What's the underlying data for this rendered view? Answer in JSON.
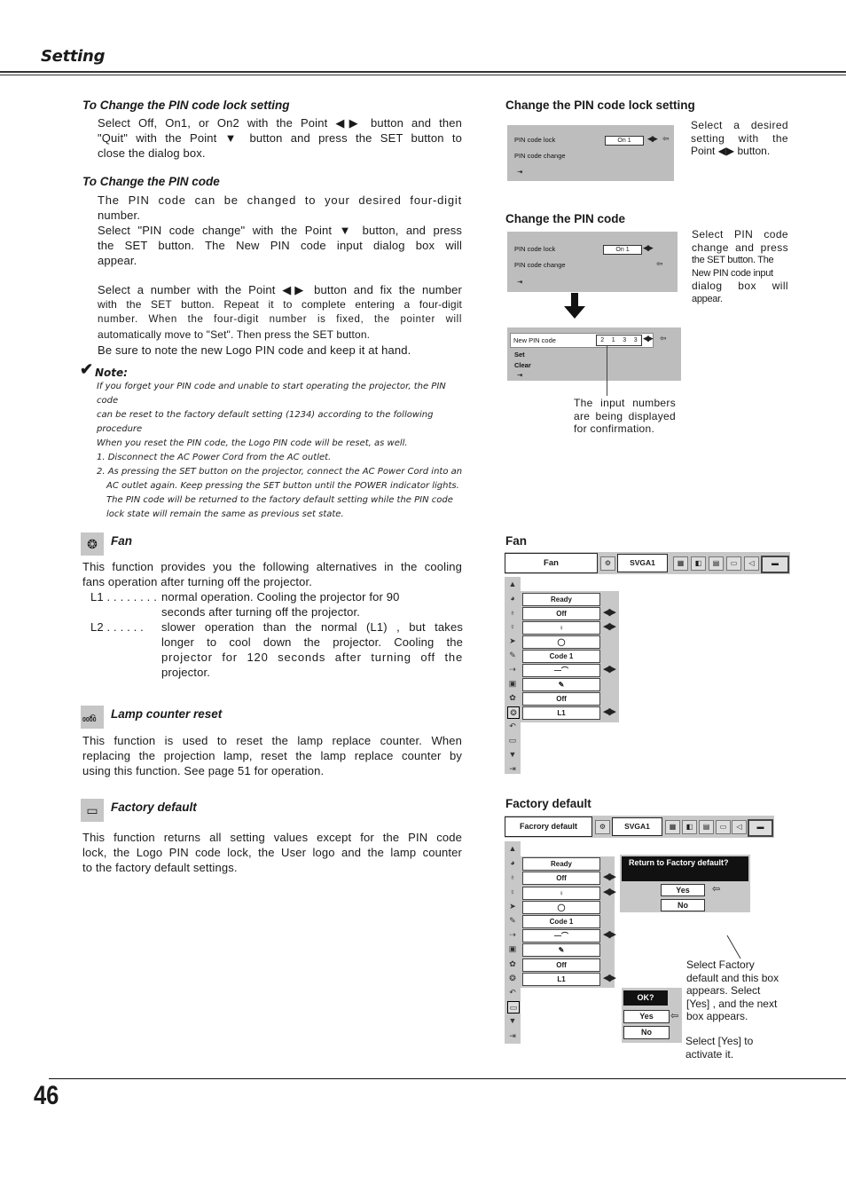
{
  "header": {
    "section_title": "Setting"
  },
  "footer": {
    "page_number": "46"
  },
  "left": {
    "pin_lock": {
      "heading": "To Change the PIN code lock setting",
      "lines": [
        "Select Off, On1, or On2 with the Point ◀▶ button and then",
        "\"Quit\" with the Point ▼ button and press the SET button to",
        "close the dialog box."
      ]
    },
    "pin_change": {
      "heading": "To Change the PIN code",
      "lines": [
        "The PIN code can be changed to your desired four-digit",
        "number.",
        "Select \"PIN code change\" with the Point ▼ button, and press",
        "the SET button.  The New PIN code input dialog box will",
        "appear."
      ],
      "lines2": [
        "Select a number with the Point ◀▶ button and fix the number",
        "with the SET button. Repeat it to complete entering a four-digit",
        "number.  When the four-digit number is fixed, the pointer will",
        "automatically move to \"Set\".  Then press the SET button.",
        "Be sure to note the new Logo PIN code and keep it at hand."
      ]
    },
    "note": {
      "title": "Note:",
      "lines": [
        "If you forget your PIN code and unable to start operating the projector, the PIN code",
        "can be reset to the factory default setting (1234) according to the following procedure",
        "When you reset the PIN code, the Logo PIN code will be reset, as well.",
        "1. Disconnect the AC Power Cord from the AC outlet.",
        "2. As pressing the SET button on the projector, connect the AC Power Cord into an",
        "AC outlet again.  Keep pressing the SET button until the POWER indicator lights.",
        "The PIN code will be returned to the factory default setting while the PIN code",
        "lock state will remain the same as previous set state."
      ]
    },
    "fan": {
      "heading": "Fan",
      "intro": [
        "This function provides you the following alternatives in the cooling",
        "fans operation after turning off the projector."
      ],
      "options": [
        {
          "key": "L1",
          "dots": " . . . . . . . .",
          "lines": [
            "normal operation. Cooling the projector for 90",
            "seconds after turning off the projector."
          ]
        },
        {
          "key": "L2",
          "dots": " . . . . . .",
          "lines": [
            "slower operation than the normal (L1) , but takes",
            "longer to cool down the projector.  Cooling the",
            "projector for 120 seconds after turning off the",
            "projector."
          ]
        }
      ]
    },
    "lamp": {
      "heading": "Lamp counter reset",
      "lines": [
        "This function is used to reset the lamp replace counter.  When",
        "replacing the projection lamp, reset the lamp replace counter by",
        "using this function.  See page 51 for operation."
      ]
    },
    "factory": {
      "heading": "Factory default",
      "lines": [
        "This function returns all setting values except for the PIN code",
        "lock, the Logo PIN code lock, the User logo and the lamp counter",
        "to the factory default settings."
      ]
    }
  },
  "right": {
    "lock_setting": {
      "heading": "Change the PIN code lock setting",
      "row1": "PIN code lock",
      "row1_value": "On 1",
      "row2": "PIN code change",
      "side": [
        "Select a desired",
        "setting with the",
        "Point ◀▶ button."
      ]
    },
    "change_code": {
      "heading": "Change the PIN code",
      "row1": "PIN code lock",
      "row1_value": "On 1",
      "row2": "PIN code change",
      "side": [
        "Select PIN code",
        "change and press",
        "the SET button.  The",
        "New PIN code input",
        "dialog box will",
        "appear."
      ],
      "new_pin_label": "New PIN code",
      "digits": [
        "2",
        "1",
        "3",
        "3"
      ],
      "set_label": "Set",
      "clear_label": "Clear",
      "callout": [
        "The input numbers",
        "are being displayed",
        "for confirmation."
      ]
    },
    "fan_menu": {
      "heading": "Fan",
      "title": "Fan",
      "source": "SVGA1",
      "rows": [
        "Ready",
        "Off",
        "",
        "",
        "Code 1",
        "",
        "",
        "Off",
        "L1"
      ],
      "row_arrows": [
        false,
        true,
        true,
        false,
        false,
        true,
        false,
        false,
        true
      ]
    },
    "factory_menu": {
      "heading": "Factory default",
      "title": "Facrory default",
      "source": "SVGA1",
      "rows": [
        "Ready",
        "Off",
        "",
        "",
        "Code 1",
        "",
        "",
        "Off",
        "L1"
      ],
      "confirm_title": "Return to Factory default?",
      "yes": "Yes",
      "no": "No",
      "ok_title": "OK?",
      "ok_yes": "Yes",
      "ok_no": "No",
      "callout": [
        "Select Factory",
        "default and this box",
        "appears.  Select",
        "[Yes] , and the next",
        "box appears."
      ],
      "callout2": [
        "Select [Yes] to",
        "activate it."
      ]
    }
  }
}
